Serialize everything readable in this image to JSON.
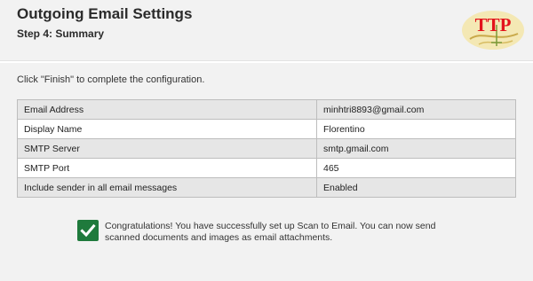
{
  "header": {
    "title": "Outgoing Email Settings",
    "subtitle": "Step 4: Summary",
    "logo_text": "TTP"
  },
  "instruction": "Click \"Finish\" to complete the configuration.",
  "summary": {
    "rows": [
      {
        "label": "Email Address",
        "value": "minhtri8893@gmail.com"
      },
      {
        "label": "Display Name",
        "value": "Florentino"
      },
      {
        "label": "SMTP Server",
        "value": "smtp.gmail.com"
      },
      {
        "label": "SMTP Port",
        "value": "465"
      },
      {
        "label": "Include sender in all email messages",
        "value": "Enabled"
      }
    ]
  },
  "success": {
    "icon": "checkmark-icon",
    "message": "Congratulations! You have successfully set up Scan to Email. You can now send scanned documents and images as email attachments."
  },
  "colors": {
    "background": "#f2f2f2",
    "success_green": "#1f7a3c",
    "logo_red": "#e3131b",
    "logo_bg": "#f4e8b4"
  }
}
